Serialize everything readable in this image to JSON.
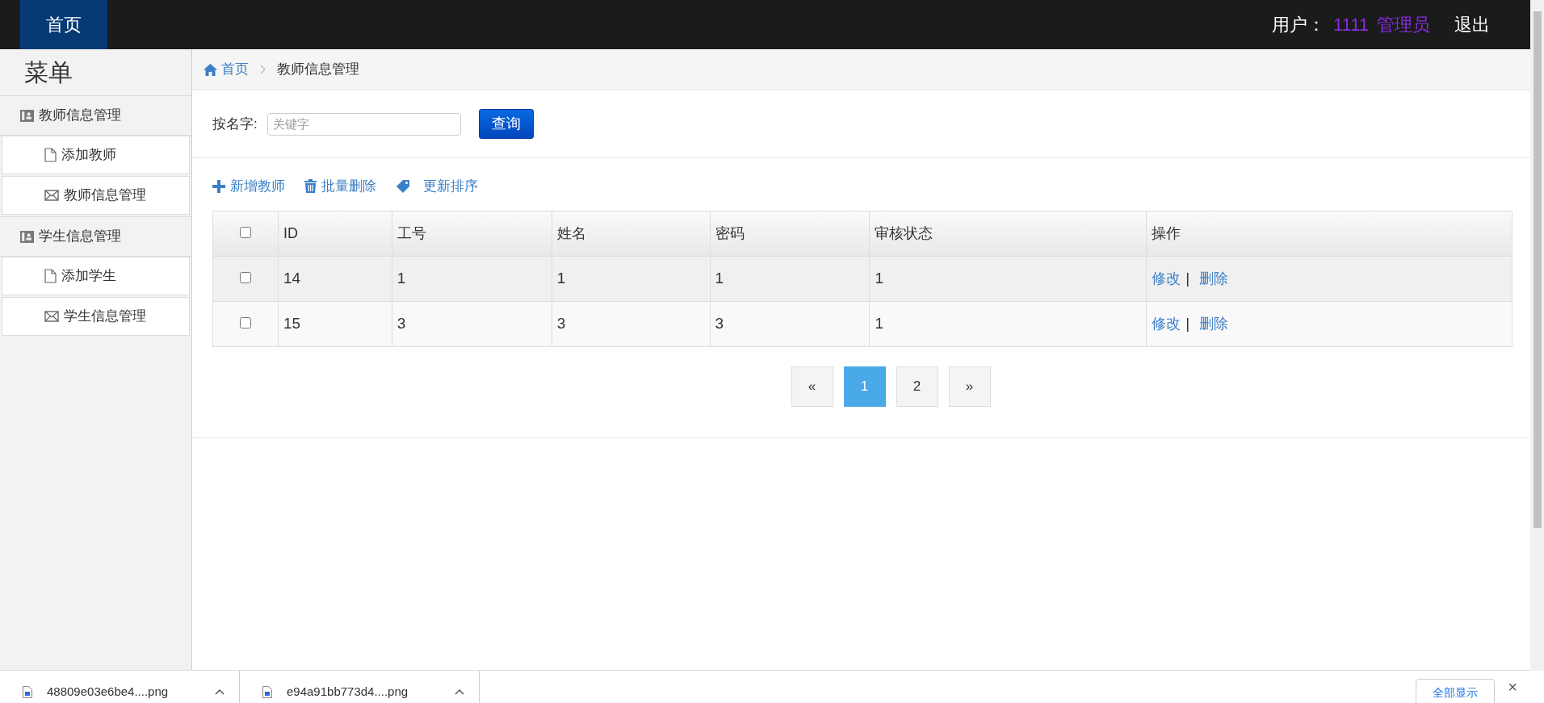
{
  "navbar": {
    "brand": "首页",
    "user_label": "用户：",
    "user_id": "1111",
    "role": "管理员",
    "logout": "退出"
  },
  "sidebar": {
    "title": "菜单",
    "groups": [
      {
        "label": "教师信息管理",
        "children": [
          {
            "label": "添加教师",
            "kind": "file"
          },
          {
            "label": "教师信息管理",
            "kind": "mail"
          }
        ]
      },
      {
        "label": "学生信息管理",
        "children": [
          {
            "label": "添加学生",
            "kind": "file"
          },
          {
            "label": "学生信息管理",
            "kind": "mail"
          }
        ]
      }
    ]
  },
  "breadcrumb": [
    {
      "label": "首页",
      "kind": "link"
    },
    {
      "label": "教师信息管理",
      "kind": "current"
    }
  ],
  "search": {
    "label": "按名字:",
    "placeholder": "关键字",
    "button": "查询"
  },
  "toolbar": [
    {
      "label": "新增教师",
      "kind": "plus"
    },
    {
      "label": "批量删除",
      "kind": "trash"
    },
    {
      "label": "更新排序",
      "kind": "tag"
    }
  ],
  "table": {
    "header_checked": false,
    "columns": [
      "ID",
      "工号",
      "姓名",
      "密码",
      "审核状态",
      "操作"
    ],
    "rows": [
      {
        "checked": false,
        "cells": [
          "14",
          "1",
          "1",
          "1",
          "1"
        ],
        "actions": [
          "修改",
          "删除"
        ],
        "separator": "|"
      },
      {
        "checked": false,
        "cells": [
          "15",
          "3",
          "3",
          "3",
          "1"
        ],
        "actions": [
          "修改",
          "删除"
        ],
        "separator": "|"
      }
    ]
  },
  "pagination": [
    {
      "label": "«",
      "selected": false
    },
    {
      "label": "1",
      "selected": true
    },
    {
      "label": "2",
      "selected": false
    },
    {
      "label": "»",
      "selected": false
    }
  ],
  "downloads": {
    "items": [
      "48809e03e6be4....png",
      "e94a91bb773d4....png"
    ],
    "show_all": "全部显示",
    "close": "×"
  }
}
